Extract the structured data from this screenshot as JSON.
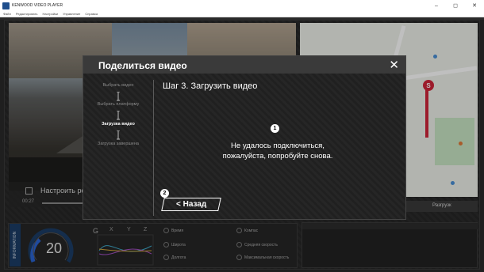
{
  "window": {
    "title": "KENWOOD VIDEO PLAYER",
    "minimize": "–",
    "restore": "◻",
    "close": "✕"
  },
  "menu": [
    "Файл",
    "Редактировать",
    "Настройки",
    "Управление",
    "Справка"
  ],
  "video": {
    "control_label": "Настроить ре",
    "time": "00:27"
  },
  "map": {
    "pin_letter": "S"
  },
  "map_tabs": {
    "upload": "Разгрузк"
  },
  "dashboard": {
    "info_label": "INFORMATION",
    "speed": "20",
    "g_label": "G",
    "axes": [
      "X",
      "Y",
      "Z"
    ],
    "stats": {
      "time_label": "Время",
      "compass_label": "Компас",
      "latitude_label": "Широта",
      "avg_speed_label": "Средняя скорость",
      "longitude_label": "Долгота",
      "max_speed_label": "Максимальная скорость"
    }
  },
  "dialog": {
    "title": "Поделиться видео",
    "close": "✕",
    "steps": [
      "Выбрать видео",
      "Выбрать платформу",
      "Загрузка видео",
      "Загрузка завершена"
    ],
    "active_step": 2,
    "step_title": "Шаг 3. Загрузить видео",
    "error_line1": "Не удалось подключиться,",
    "error_line2": "пожалуйста, попробуйте снова.",
    "back_button": "< Назад",
    "markers": [
      "1",
      "2"
    ]
  },
  "colors": {
    "accent_blue": "#2a63d1",
    "route_red": "#d1253a",
    "info_blue": "#1b3d66"
  }
}
